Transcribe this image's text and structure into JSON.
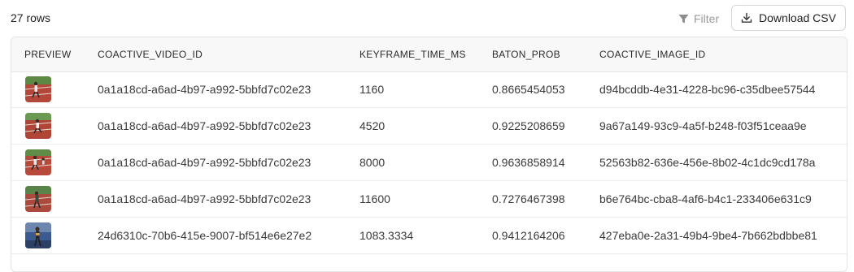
{
  "toolbar": {
    "row_count": "27 rows",
    "filter_label": "Filter",
    "download_label": "Download CSV"
  },
  "icons": {
    "filter": "filter-icon",
    "download": "download-icon"
  },
  "colors": {
    "track_red": "#b5473a",
    "track_green": "#5c8a45",
    "track_blue": "#3b5a8f"
  },
  "table": {
    "columns": [
      "PREVIEW",
      "COACTIVE_VIDEO_ID",
      "KEYFRAME_TIME_MS",
      "BATON_PROB",
      "COACTIVE_IMAGE_ID"
    ],
    "rows": [
      {
        "preview": "track-scene-thumbnail",
        "video_id": "0a1a18cd-a6ad-4b97-a992-5bbfd7c02e23",
        "time_ms": "1160",
        "baton_prob": "0.8665454053",
        "image_id": "d94bcddb-4e31-4228-bc96-c35dbee57544"
      },
      {
        "preview": "track-scene-thumbnail",
        "video_id": "0a1a18cd-a6ad-4b97-a992-5bbfd7c02e23",
        "time_ms": "4520",
        "baton_prob": "0.9225208659",
        "image_id": "9a67a149-93c9-4a5f-b248-f03f51ceaa9e"
      },
      {
        "preview": "track-scene-thumbnail",
        "video_id": "0a1a18cd-a6ad-4b97-a992-5bbfd7c02e23",
        "time_ms": "8000",
        "baton_prob": "0.9636858914",
        "image_id": "52563b82-636e-456e-8b02-4c1dc9cd178a"
      },
      {
        "preview": "track-scene-thumbnail",
        "video_id": "0a1a18cd-a6ad-4b97-a992-5bbfd7c02e23",
        "time_ms": "11600",
        "baton_prob": "0.7276467398",
        "image_id": "b6e764bc-cba8-4af6-b4c1-233406e631c9"
      },
      {
        "preview": "track-scene-thumbnail",
        "video_id": "24d6310c-70b6-415e-9007-bf514e6e27e2",
        "time_ms": "1083.3334",
        "baton_prob": "0.9412164206",
        "image_id": "427eba0e-2a31-49b4-9be4-7b662bdbbe81"
      }
    ]
  }
}
